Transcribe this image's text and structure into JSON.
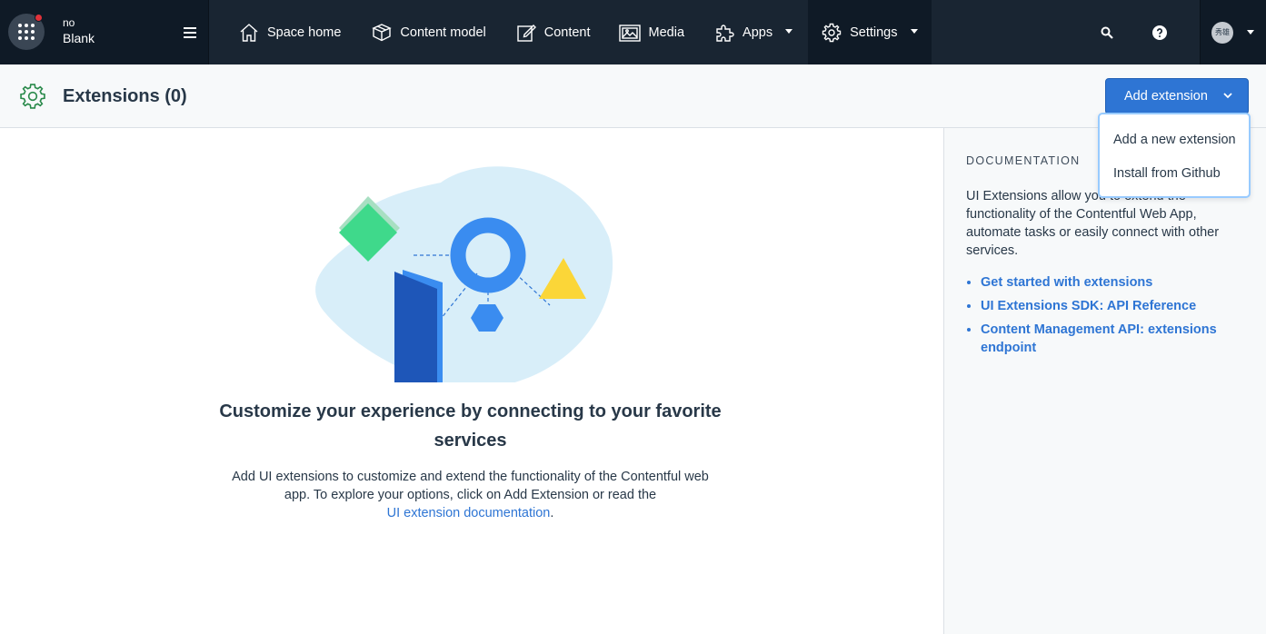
{
  "topbar": {
    "space": {
      "org_name": "no",
      "environment_name": "Blank"
    },
    "nav": [
      {
        "label": "Space home",
        "icon": "home-icon"
      },
      {
        "label": "Content model",
        "icon": "package-icon"
      },
      {
        "label": "Content",
        "icon": "edit-icon"
      },
      {
        "label": "Media",
        "icon": "image-icon"
      },
      {
        "label": "Apps",
        "icon": "puzzle-icon"
      },
      {
        "label": "Settings",
        "icon": "gear-icon"
      }
    ],
    "avatar_text": "秀雄"
  },
  "header": {
    "title": "Extensions (0)",
    "add_button_label": "Add extension"
  },
  "dropdown": {
    "items": [
      "Add a new extension",
      "Install from Github"
    ]
  },
  "empty_state": {
    "heading": "Customize your experience by connecting to your favorite services",
    "body_text": "Add UI extensions to customize and extend the functionality of the Contentful web app. To explore your options, click on Add Extension or read the",
    "link_text": "UI extension documentation",
    "trailing_period": "."
  },
  "sidebar": {
    "heading": "DOCUMENTATION",
    "description": "UI Extensions allow you to extend the functionality of the Contentful Web App, automate tasks or easily connect with other services.",
    "links": [
      "Get started with extensions",
      "UI Extensions SDK: API Reference",
      "Content Management API: extensions endpoint"
    ]
  },
  "colors": {
    "nav_bg": "#192532",
    "primary": "#2e75d4",
    "header_bg": "#f7f9fa",
    "gear_green": "#2a8a4b"
  }
}
